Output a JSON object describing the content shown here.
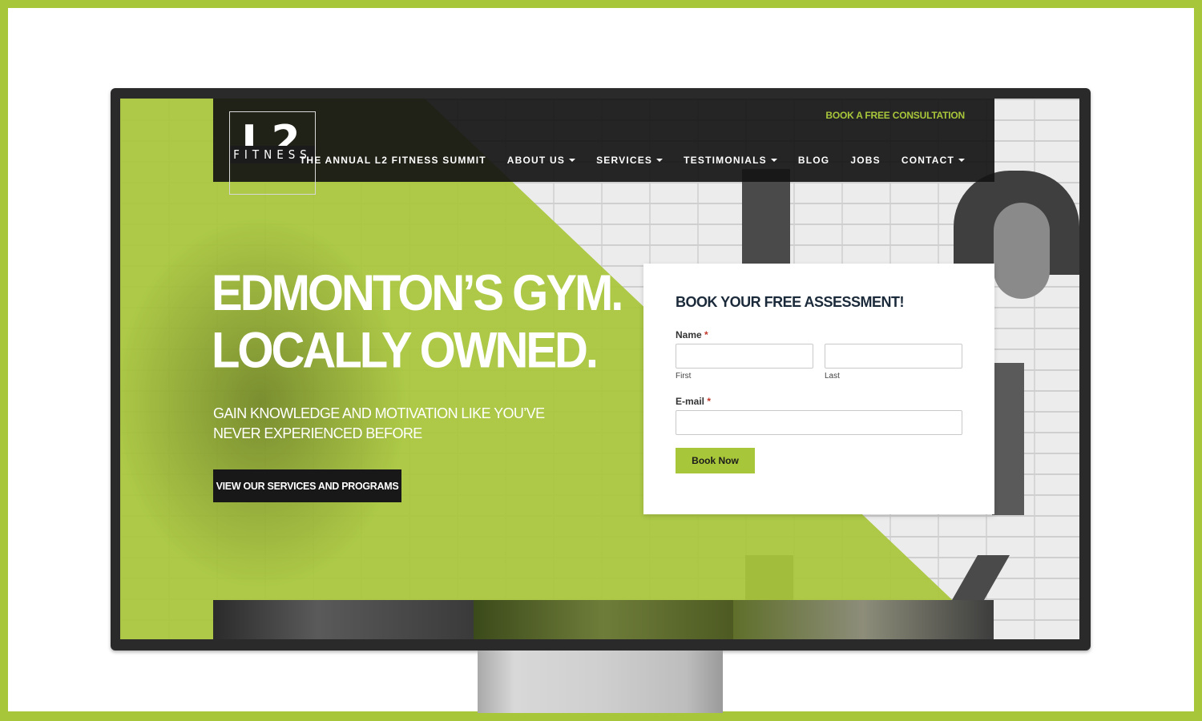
{
  "brand": {
    "logo_main": "L2",
    "logo_sub": "FITNESS",
    "accent": "#a8c63a"
  },
  "header": {
    "consult_link": "BOOK A FREE CONSULTATION",
    "nav": [
      {
        "label": "THE ANNUAL L2 FITNESS SUMMIT",
        "dropdown": false
      },
      {
        "label": "ABOUT US",
        "dropdown": true
      },
      {
        "label": "SERVICES",
        "dropdown": true
      },
      {
        "label": "TESTIMONIALS",
        "dropdown": true
      },
      {
        "label": "BLOG",
        "dropdown": false
      },
      {
        "label": "JOBS",
        "dropdown": false
      },
      {
        "label": "CONTACT",
        "dropdown": true
      }
    ]
  },
  "hero": {
    "line1": "EDMONTON’S GYM.",
    "line2": "LOCALLY OWNED.",
    "sub1": "GAIN KNOWLEDGE AND MOTIVATION LIKE YOU’VE",
    "sub2": "NEVER EXPERIENCED BEFORE",
    "cta": "VIEW OUR SERVICES AND PROGRAMS"
  },
  "form": {
    "title": "BOOK YOUR FREE ASSESSMENT!",
    "name_label": "Name",
    "required_mark": "*",
    "first_label": "First",
    "last_label": "Last",
    "email_label": "E-mail",
    "submit": "Book Now"
  }
}
